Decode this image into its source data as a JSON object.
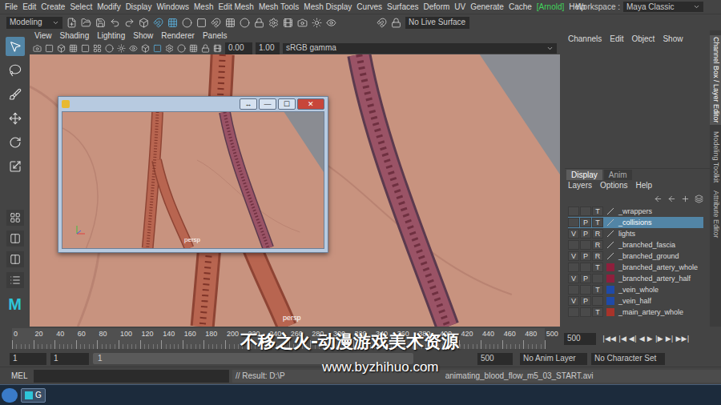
{
  "menu_bar": {
    "items": [
      {
        "label": "File",
        "highlight": false
      },
      {
        "label": "Edit",
        "highlight": false
      },
      {
        "label": "Create",
        "highlight": false
      },
      {
        "label": "Select",
        "highlight": false
      },
      {
        "label": "Modify",
        "highlight": false
      },
      {
        "label": "Display",
        "highlight": false
      },
      {
        "label": "Windows",
        "highlight": false
      },
      {
        "label": "Mesh",
        "highlight": false
      },
      {
        "label": "Edit Mesh",
        "highlight": false
      },
      {
        "label": "Mesh Tools",
        "highlight": false
      },
      {
        "label": "Mesh Display",
        "highlight": false
      },
      {
        "label": "Curves",
        "highlight": false
      },
      {
        "label": "Surfaces",
        "highlight": false
      },
      {
        "label": "Deform",
        "highlight": false
      },
      {
        "label": "UV",
        "highlight": false
      },
      {
        "label": "Generate",
        "highlight": false
      },
      {
        "label": "Cache",
        "highlight": false
      },
      {
        "label": "[Arnold]",
        "highlight": true
      },
      {
        "label": "Help",
        "highlight": false
      }
    ],
    "workspace_label": "Workspace :",
    "workspace": "Maya Classic"
  },
  "status_line": {
    "mode": "Modeling",
    "live_surface": "No Live Surface"
  },
  "toolbox": {
    "tools": [
      {
        "kind": "select",
        "selected": true
      },
      {
        "kind": "lasso",
        "selected": false
      },
      {
        "kind": "paint",
        "selected": false
      },
      {
        "kind": "move",
        "selected": false
      },
      {
        "kind": "rotate",
        "selected": false
      },
      {
        "kind": "scale",
        "selected": false
      }
    ],
    "logo": "M"
  },
  "panel": {
    "menu": [
      "View",
      "Shading",
      "Lighting",
      "Show",
      "Renderer",
      "Panels"
    ],
    "exposure": "0.00",
    "gamma": "1.00",
    "color_space": "sRGB gamma",
    "camera": "persp"
  },
  "floating_window": {
    "buttons": [
      "↔",
      "—",
      "☐",
      "✕"
    ],
    "camera": "persp"
  },
  "channel_box": {
    "menu": [
      "Channels",
      "Edit",
      "Object",
      "Show"
    ]
  },
  "layer_editor": {
    "tabs": [
      {
        "label": "Display",
        "selected": true
      },
      {
        "label": "Anim",
        "selected": false
      }
    ],
    "menu": [
      "Layers",
      "Options",
      "Help"
    ],
    "layers": [
      {
        "v": "",
        "p": "",
        "r": "T",
        "name": "_wrappers",
        "selected": false
      },
      {
        "v": "",
        "p": "P",
        "r": "T",
        "name": "_collisions",
        "selected": true
      },
      {
        "v": "V",
        "p": "P",
        "r": "R",
        "name": "lights",
        "selected": false
      },
      {
        "v": "",
        "p": "",
        "r": "R",
        "name": "_branched_fascia",
        "selected": false
      },
      {
        "v": "V",
        "p": "P",
        "r": "R",
        "name": "_branched_ground",
        "selected": false
      },
      {
        "v": "",
        "p": "",
        "r": "T",
        "name": "_branched_artery_whole",
        "selected": false,
        "color": "#8e1f3c"
      },
      {
        "v": "V",
        "p": "P",
        "r": "",
        "name": "_branched_artery_half",
        "selected": false,
        "color": "#8e1f3c"
      },
      {
        "v": "",
        "p": "",
        "r": "T",
        "name": "_vein_whole",
        "selected": false,
        "color": "#1f4aa8"
      },
      {
        "v": "V",
        "p": "P",
        "r": "",
        "name": "_vein_half",
        "selected": false,
        "color": "#1f4aa8"
      },
      {
        "v": "",
        "p": "",
        "r": "T",
        "name": "_main_artery_whole",
        "selected": false,
        "color": "#a8332a"
      }
    ]
  },
  "side_tabs": [
    {
      "label": "Channel Box / Layer Editor",
      "selected": true
    },
    {
      "label": "Modeling Toolkit",
      "selected": false
    },
    {
      "label": "Attribute Editor",
      "selected": false
    }
  ],
  "timeline": {
    "ticks": [
      "0",
      "20",
      "40",
      "60",
      "80",
      "100",
      "120",
      "140",
      "160",
      "180",
      "200",
      "220",
      "240",
      "260",
      "280",
      "300",
      "320",
      "340",
      "360",
      "380",
      "400",
      "420",
      "440",
      "460",
      "480",
      "500"
    ],
    "current_time": "500",
    "controls": [
      "|◀◀",
      "|◀",
      "◀|",
      "◀",
      "▶",
      "|▶",
      "▶|",
      "▶▶|"
    ]
  },
  "range_slider": {
    "start": "1",
    "anim_start": "1",
    "slider_start": "1",
    "end": "500",
    "anim_layer": "No Anim Layer",
    "character_set": "No Character Set"
  },
  "command_line": {
    "language": "MEL",
    "result_left": "// Result: D:\\P",
    "result_right": "animating_blood_flow_m5_03_START.avi"
  },
  "taskbar": {
    "app_label": "G"
  },
  "watermark": {
    "title": "不移之火-动漫游戏美术资源",
    "url": "www.byzhihuo.com"
  }
}
